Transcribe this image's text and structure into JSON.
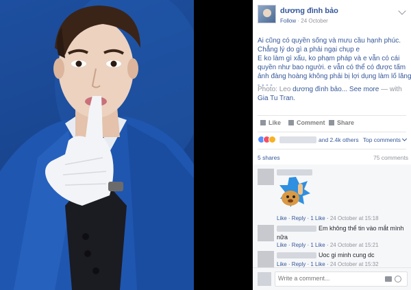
{
  "post": {
    "author": "dương đình bảo",
    "follow_label": "Follow",
    "separator": "·",
    "date": "24 October",
    "caption_lines": [
      "Ai cũng có quyền sống và mưu cầu hạnh phúc.",
      "Chẳng lý do gì a phải ngại chụp e",
      "E ko làm gì xấu, ko phạm pháp và e vẫn có cái",
      "quyền như bao người. e vẫn có thể có được tấm",
      "ảnh đàng hoàng không phải bị lợi dụng làm lố lăng.",
      "- - - -"
    ],
    "credit_prefix": "Photo: Leo",
    "credit_person": "dương đình bảo...",
    "see_more": "See more",
    "with_text": "— with",
    "tagged": "Gia Tu Tran."
  },
  "actions": {
    "like": "Like",
    "comment": "Comment",
    "share": "Share"
  },
  "reactions": {
    "others": "and 2.4k others",
    "top_comments": "Top comments",
    "shares": "5 shares",
    "comments_count": "75 comments",
    "colors": {
      "like": "#5890ff",
      "love": "#f25268",
      "wow": "#f7b125"
    }
  },
  "comments": [
    {
      "text": "",
      "like_label": "Like",
      "reply_label": "Reply",
      "likes": "1 Like",
      "time": "24 October at 15:18",
      "has_sticker": true
    },
    {
      "text_line1": "Em không thể tin vào mắt mình",
      "text_line2": "nữa",
      "like_label": "Like",
      "reply_label": "Reply",
      "likes": "1 Like",
      "time": "24 October at 15:21"
    },
    {
      "text": "Uoc gi minh cung dc",
      "like_label": "Like",
      "reply_label": "Reply",
      "likes": "1 Like",
      "time": "24 October at 15:32"
    }
  ],
  "composer": {
    "placeholder": "Write a comment..."
  },
  "colors": {
    "link": "#365899",
    "meta": "#90949c",
    "photo_background": "#1a4690"
  }
}
